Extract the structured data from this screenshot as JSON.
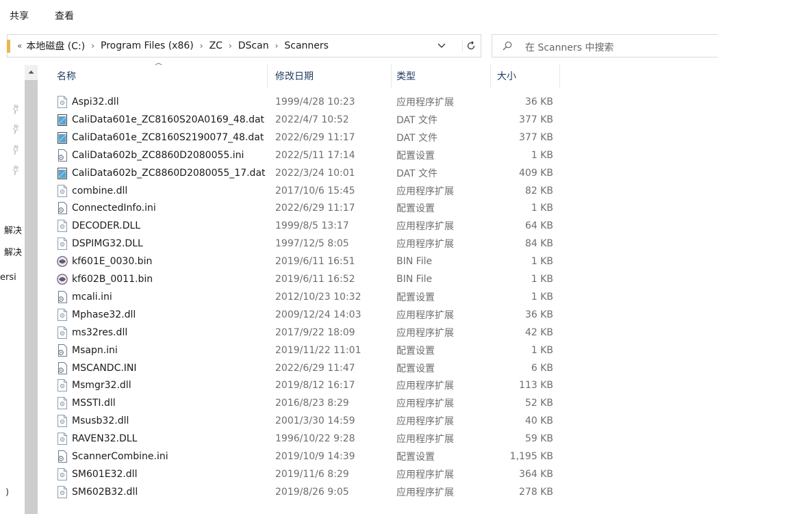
{
  "ribbon": {
    "tabs": [
      "共享",
      "查看"
    ]
  },
  "address": {
    "overflow": "«",
    "crumbs": [
      "本地磁盘 (C:)",
      "Program Files (x86)",
      "ZC",
      "DScan",
      "Scanners"
    ],
    "separator": "›",
    "dropdown_icon": "chevron-down-icon",
    "refresh_icon": "refresh-icon"
  },
  "search": {
    "placeholder": "在 Scanners 中搜索",
    "icon": "search-icon"
  },
  "nav": {
    "texts": [
      "解决",
      "解决",
      "ersi",
      ")"
    ],
    "pin_count": 4
  },
  "columns": {
    "name": "名称",
    "date": "修改日期",
    "type": "类型",
    "size": "大小",
    "sorted_by": "name"
  },
  "icon_colors": {
    "dll": "#8a9bb0",
    "dat": "#5ba3d0",
    "ini": "#6b7a8c",
    "bin": "#7a4b2a"
  },
  "files": [
    {
      "name": "Aspi32.dll",
      "date": "1999/4/28 10:23",
      "type": "应用程序扩展",
      "size": "36 KB",
      "icon": "dll"
    },
    {
      "name": "CaliData601e_ZC8160S20A0169_48.dat",
      "date": "2022/4/7 10:52",
      "type": "DAT 文件",
      "size": "377 KB",
      "icon": "dat"
    },
    {
      "name": "CaliData601e_ZC8160S2190077_48.dat",
      "date": "2022/6/29 11:17",
      "type": "DAT 文件",
      "size": "377 KB",
      "icon": "dat"
    },
    {
      "name": "CaliData602b_ZC8860D2080055.ini",
      "date": "2022/5/11 17:14",
      "type": "配置设置",
      "size": "1 KB",
      "icon": "ini"
    },
    {
      "name": "CaliData602b_ZC8860D2080055_17.dat",
      "date": "2022/3/24 10:01",
      "type": "DAT 文件",
      "size": "409 KB",
      "icon": "dat"
    },
    {
      "name": "combine.dll",
      "date": "2017/10/6 15:45",
      "type": "应用程序扩展",
      "size": "82 KB",
      "icon": "dll"
    },
    {
      "name": "ConnectedInfo.ini",
      "date": "2022/6/29 11:17",
      "type": "配置设置",
      "size": "1 KB",
      "icon": "ini"
    },
    {
      "name": "DECODER.DLL",
      "date": "1999/8/5 13:17",
      "type": "应用程序扩展",
      "size": "64 KB",
      "icon": "dll"
    },
    {
      "name": "DSPIMG32.DLL",
      "date": "1997/12/5 8:05",
      "type": "应用程序扩展",
      "size": "84 KB",
      "icon": "dll"
    },
    {
      "name": "kf601E_0030.bin",
      "date": "2019/6/11 16:51",
      "type": "BIN File",
      "size": "1 KB",
      "icon": "bin"
    },
    {
      "name": "kf602B_0011.bin",
      "date": "2019/6/11 16:52",
      "type": "BIN File",
      "size": "1 KB",
      "icon": "bin"
    },
    {
      "name": "mcali.ini",
      "date": "2012/10/23 10:32",
      "type": "配置设置",
      "size": "1 KB",
      "icon": "ini"
    },
    {
      "name": "Mphase32.dll",
      "date": "2009/12/24 14:03",
      "type": "应用程序扩展",
      "size": "36 KB",
      "icon": "dll"
    },
    {
      "name": "ms32res.dll",
      "date": "2017/9/22 18:09",
      "type": "应用程序扩展",
      "size": "42 KB",
      "icon": "dll"
    },
    {
      "name": "Msapn.ini",
      "date": "2019/11/22 11:01",
      "type": "配置设置",
      "size": "1 KB",
      "icon": "ini"
    },
    {
      "name": "MSCANDC.INI",
      "date": "2022/6/29 11:47",
      "type": "配置设置",
      "size": "6 KB",
      "icon": "ini"
    },
    {
      "name": "Msmgr32.dll",
      "date": "2019/8/12 16:17",
      "type": "应用程序扩展",
      "size": "113 KB",
      "icon": "dll"
    },
    {
      "name": "MSSTI.dll",
      "date": "2016/8/23 8:29",
      "type": "应用程序扩展",
      "size": "52 KB",
      "icon": "dll"
    },
    {
      "name": "Msusb32.dll",
      "date": "2001/3/30 14:59",
      "type": "应用程序扩展",
      "size": "40 KB",
      "icon": "dll"
    },
    {
      "name": "RAVEN32.DLL",
      "date": "1996/10/22 9:28",
      "type": "应用程序扩展",
      "size": "59 KB",
      "icon": "dll"
    },
    {
      "name": "ScannerCombine.ini",
      "date": "2019/10/9 14:39",
      "type": "配置设置",
      "size": "1,195 KB",
      "icon": "ini"
    },
    {
      "name": "SM601E32.dll",
      "date": "2019/11/6 8:29",
      "type": "应用程序扩展",
      "size": "364 KB",
      "icon": "dll"
    },
    {
      "name": "SM602B32.dll",
      "date": "2019/8/26 9:05",
      "type": "应用程序扩展",
      "size": "278 KB",
      "icon": "dll"
    }
  ]
}
